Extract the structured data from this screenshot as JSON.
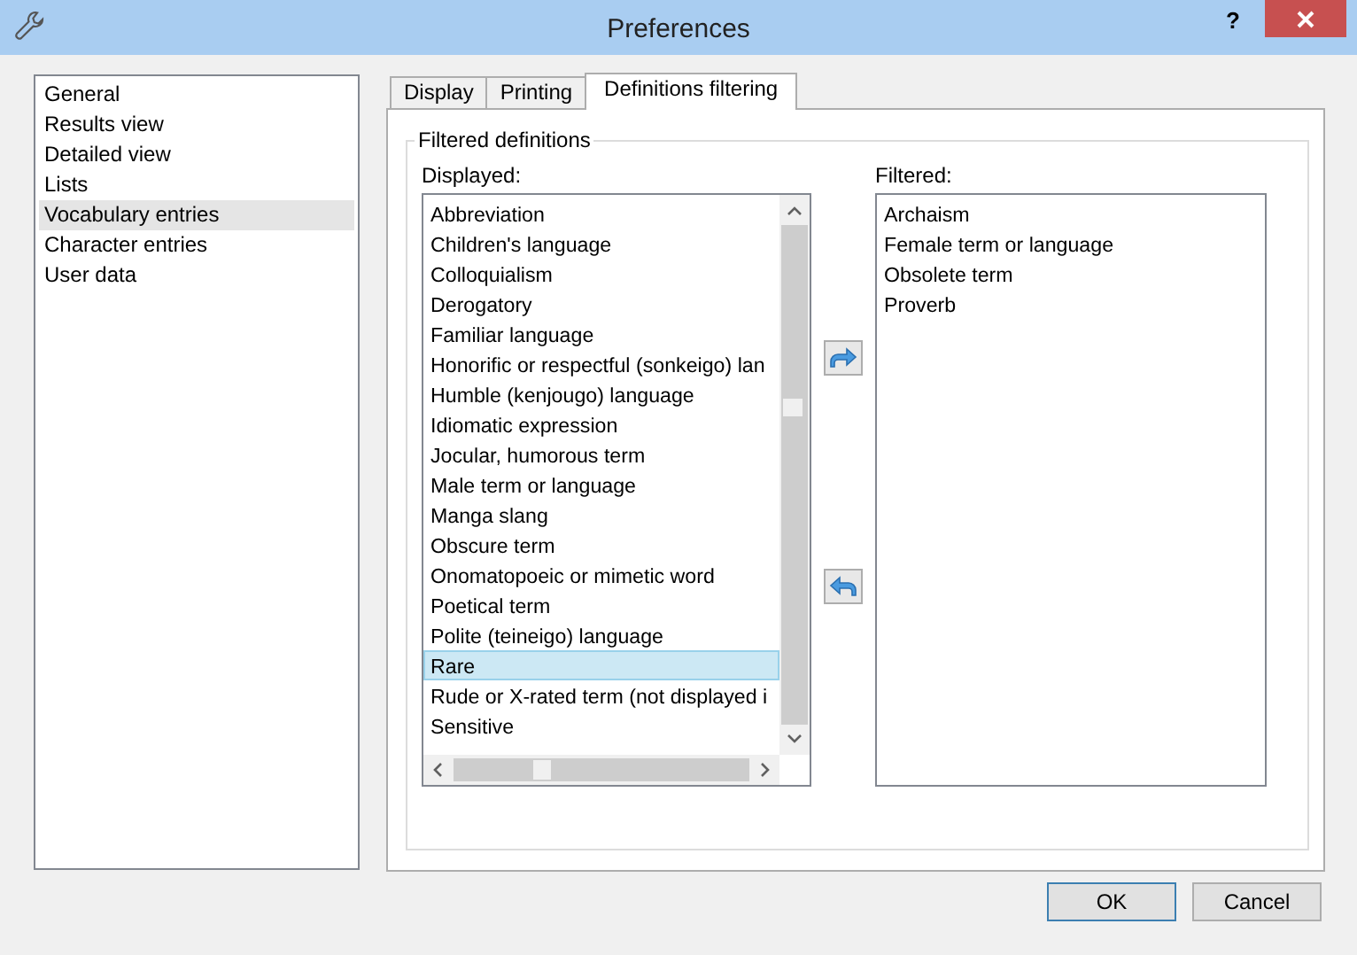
{
  "window": {
    "title": "Preferences",
    "help": "?"
  },
  "sidebar": {
    "items": [
      {
        "label": "General",
        "selected": false
      },
      {
        "label": "Results view",
        "selected": false
      },
      {
        "label": "Detailed view",
        "selected": false
      },
      {
        "label": "Lists",
        "selected": false
      },
      {
        "label": "Vocabulary entries",
        "selected": true
      },
      {
        "label": "Character entries",
        "selected": false
      },
      {
        "label": "User data",
        "selected": false
      }
    ]
  },
  "tabs": [
    {
      "label": "Display",
      "selected": false
    },
    {
      "label": "Printing",
      "selected": false
    },
    {
      "label": "Definitions filtering",
      "selected": true
    }
  ],
  "group": {
    "title": "Filtered definitions"
  },
  "displayed": {
    "label": "Displayed:",
    "items": [
      {
        "label": "Abbreviation",
        "selected": false
      },
      {
        "label": "Children's language",
        "selected": false
      },
      {
        "label": "Colloquialism",
        "selected": false
      },
      {
        "label": "Derogatory",
        "selected": false
      },
      {
        "label": "Familiar language",
        "selected": false
      },
      {
        "label": "Honorific or respectful (sonkeigo) lan",
        "selected": false
      },
      {
        "label": "Humble (kenjougo) language",
        "selected": false
      },
      {
        "label": "Idiomatic expression",
        "selected": false
      },
      {
        "label": "Jocular, humorous term",
        "selected": false
      },
      {
        "label": "Male term or language",
        "selected": false
      },
      {
        "label": "Manga slang",
        "selected": false
      },
      {
        "label": "Obscure term",
        "selected": false
      },
      {
        "label": "Onomatopoeic or mimetic word",
        "selected": false
      },
      {
        "label": "Poetical term",
        "selected": false
      },
      {
        "label": "Polite (teineigo) language",
        "selected": false
      },
      {
        "label": "Rare",
        "selected": true
      },
      {
        "label": "Rude or X-rated term (not displayed i",
        "selected": false
      },
      {
        "label": "Sensitive",
        "selected": false
      }
    ]
  },
  "filtered": {
    "label": "Filtered:",
    "items": [
      {
        "label": "Archaism",
        "selected": false
      },
      {
        "label": "Female term or language",
        "selected": false
      },
      {
        "label": "Obsolete term",
        "selected": false
      },
      {
        "label": "Proverb",
        "selected": false
      }
    ]
  },
  "buttons": [
    {
      "label": "OK",
      "default": true
    },
    {
      "label": "Cancel",
      "default": false
    }
  ]
}
